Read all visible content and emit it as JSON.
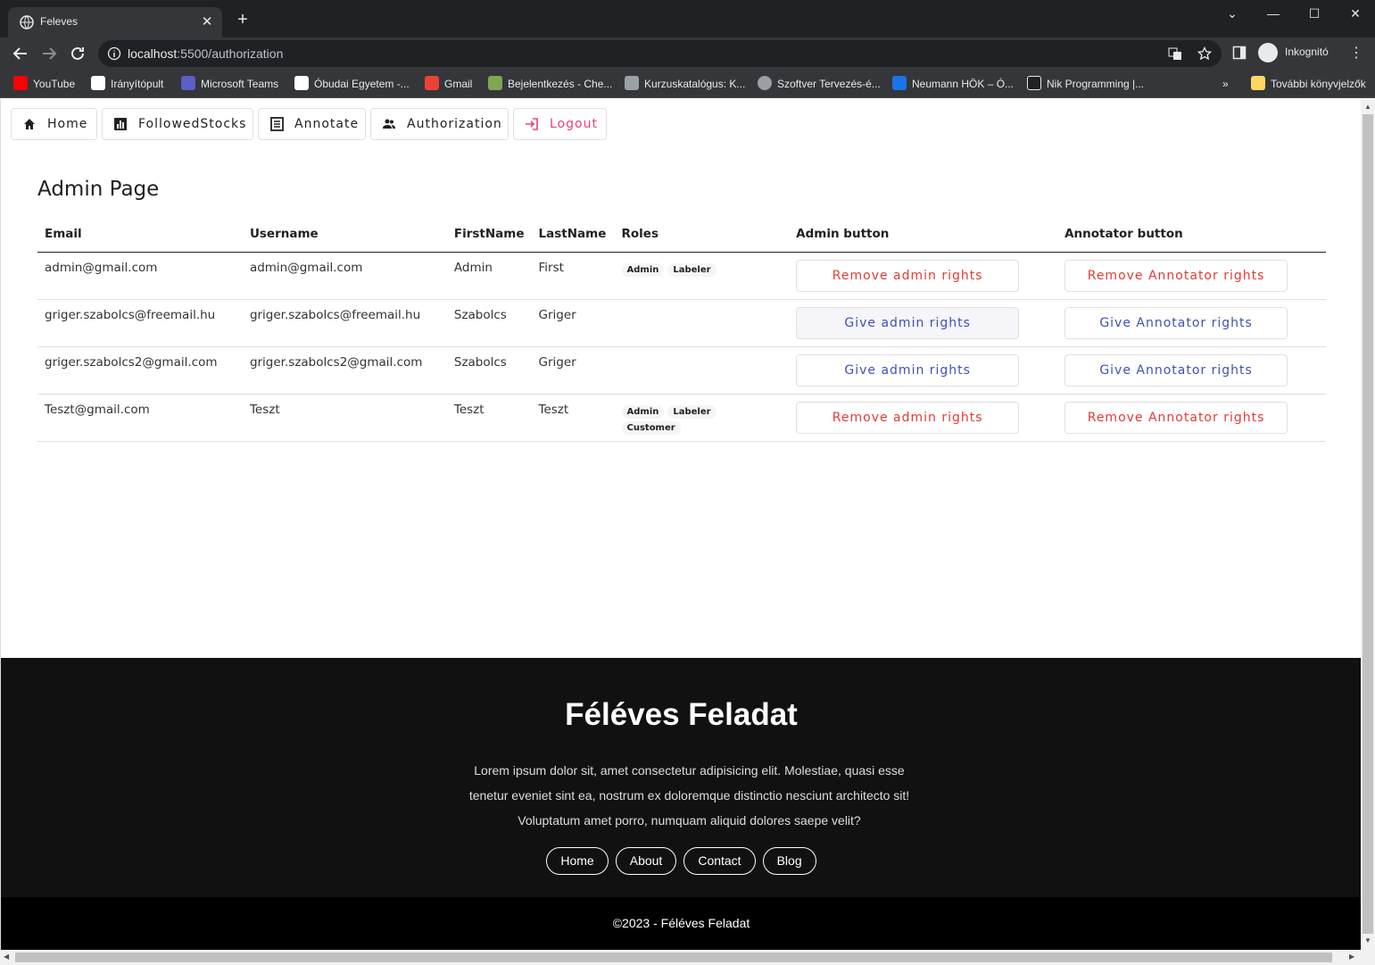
{
  "browser": {
    "tab_title": "Feleves",
    "url_host": "localhost",
    "url_rest": ":5500/authorization",
    "profile_label": "Inkognitó",
    "bookmarks": [
      {
        "label": "YouTube",
        "icon": "youtube-icon",
        "color": "#ff0000"
      },
      {
        "label": "Irányítópult",
        "icon": "oe-icon",
        "color": "#ffffff"
      },
      {
        "label": "Microsoft Teams",
        "icon": "teams-icon",
        "color": "#5b5fc7"
      },
      {
        "label": "Óbudai Egyetem -...",
        "icon": "doc-icon",
        "color": "#ffffff"
      },
      {
        "label": "Gmail",
        "icon": "gmail-icon",
        "color": "#ea4335"
      },
      {
        "label": "Bejelentkezés - Che...",
        "icon": "chess-icon",
        "color": "#7fa650"
      },
      {
        "label": "Kurzuskatalógus: K...",
        "icon": "wave-icon",
        "color": "#9aa0a6"
      },
      {
        "label": "Szoftver Tervezés-é...",
        "icon": "globe-icon",
        "color": "#9aa0a6"
      },
      {
        "label": "Neumann HÖK – Ó...",
        "icon": "nh-icon",
        "color": "#1a73e8"
      },
      {
        "label": "Nik Programming |...",
        "icon": "nik-icon",
        "color": "#202124"
      }
    ],
    "more_bookmarks": "»",
    "other_bookmarks": "További könyvjelzők"
  },
  "nav": {
    "home": "Home",
    "followed": "FollowedStocks",
    "annotate": "Annotate",
    "authorization": "Authorization",
    "logout": "Logout"
  },
  "page_title": "Admin Page",
  "table": {
    "headers": {
      "email": "Email",
      "username": "Username",
      "firstname": "FirstName",
      "lastname": "LastName",
      "roles": "Roles",
      "admin_button": "Admin button",
      "annotator_button": "Annotator button"
    },
    "rows": [
      {
        "email": "admin@gmail.com",
        "username": "admin@gmail.com",
        "firstname": "Admin",
        "lastname": "First",
        "role1": "Admin",
        "role2": "Labeler",
        "role3": "",
        "admin_btn": "Remove admin rights",
        "annot_btn": "Remove Annotator rights"
      },
      {
        "email": "griger.szabolcs@freemail.hu",
        "username": "griger.szabolcs@freemail.hu",
        "firstname": "Szabolcs",
        "lastname": "Griger",
        "role1": "",
        "role2": "",
        "role3": "",
        "admin_btn": "Give admin rights",
        "annot_btn": "Give Annotator rights"
      },
      {
        "email": "griger.szabolcs2@gmail.com",
        "username": "griger.szabolcs2@gmail.com",
        "firstname": "Szabolcs",
        "lastname": "Griger",
        "role1": "",
        "role2": "",
        "role3": "",
        "admin_btn": "Give admin rights",
        "annot_btn": "Give Annotator rights"
      },
      {
        "email": "Teszt@gmail.com",
        "username": "Teszt",
        "firstname": "Teszt",
        "lastname": "Teszt",
        "role1": "Admin",
        "role2": "Labeler",
        "role3": "Customer",
        "admin_btn": "Remove admin rights",
        "annot_btn": "Remove Annotator rights"
      }
    ]
  },
  "footer": {
    "title": "Féléves Feladat",
    "text": "Lorem ipsum dolor sit, amet consectetur adipisicing elit. Molestiae, quasi esse tenetur eveniet sint ea, nostrum ex doloremque distinctio nesciunt architecto sit! Voluptatum amet porro, numquam aliquid dolores saepe velit?",
    "links": [
      "Home",
      "About",
      "Contact",
      "Blog"
    ],
    "copyright": "©2023 - Féléves Feladat"
  },
  "colors": {
    "remove": "#e53935",
    "give": "#3f51b5",
    "logout": "#ec407a",
    "footer_bg": "#111111"
  }
}
